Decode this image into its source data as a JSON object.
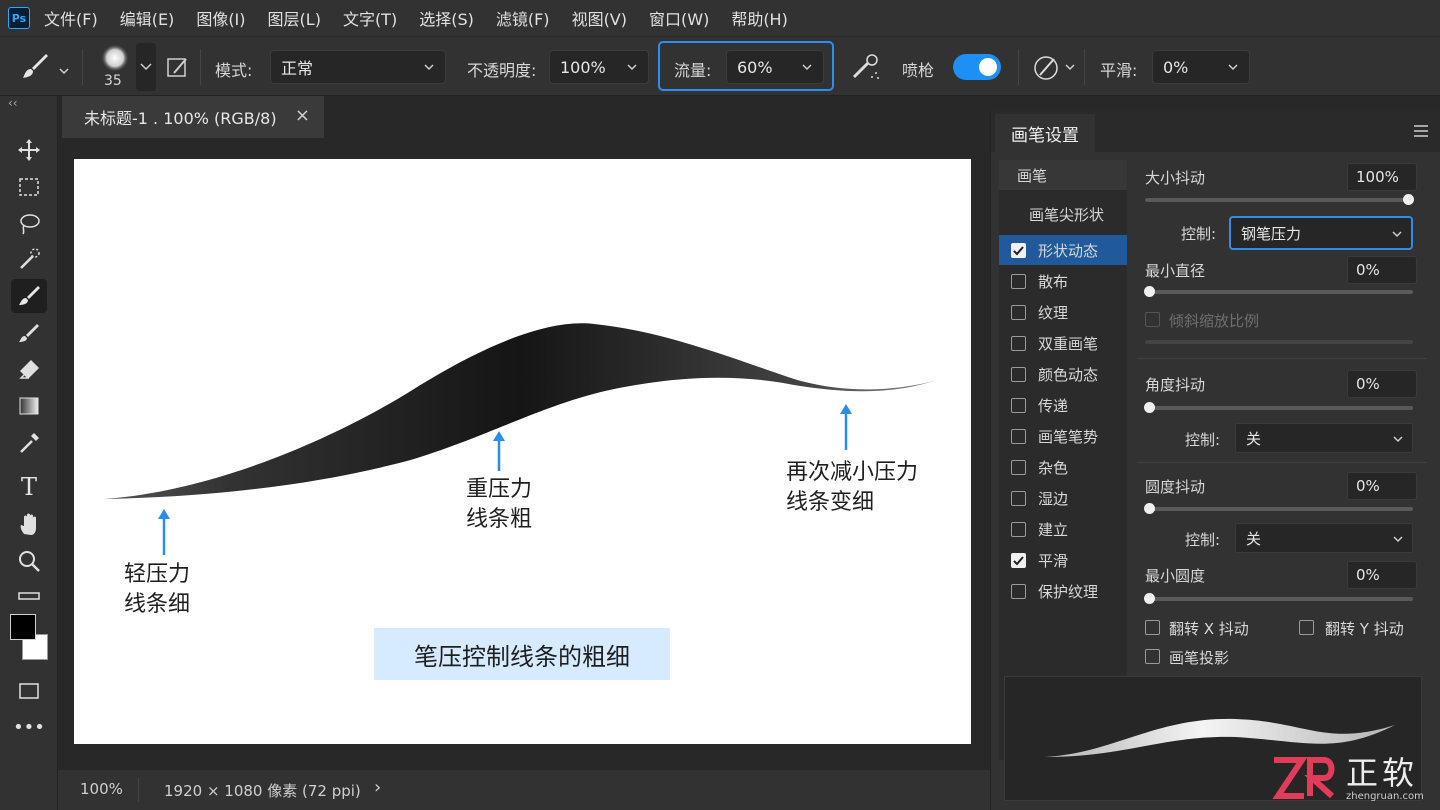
{
  "app": {
    "logo": "Ps"
  },
  "menu": [
    "文件(F)",
    "编辑(E)",
    "图像(I)",
    "图层(L)",
    "文字(T)",
    "选择(S)",
    "滤镜(F)",
    "视图(V)",
    "窗口(W)",
    "帮助(H)"
  ],
  "options": {
    "brush_size": "35",
    "mode_label": "模式:",
    "mode_value": "正常",
    "opacity_label": "不透明度:",
    "opacity_value": "100%",
    "flow_label": "流量:",
    "flow_value": "60%",
    "airbrush_label": "喷枪",
    "smoothing_label": "平滑:",
    "smoothing_value": "0%"
  },
  "document": {
    "tab_title": "未标题-1 . 100% (RGB/8)",
    "close_glyph": "×"
  },
  "canvas": {
    "anno_light_1": "轻压力",
    "anno_light_2": "线条细",
    "anno_heavy_1": "重压力",
    "anno_heavy_2": "线条粗",
    "anno_reduce_1": "再次减小压力",
    "anno_reduce_2": "线条变细",
    "caption": "笔压控制线条的粗细"
  },
  "status": {
    "zoom": "100%",
    "doc_info": "1920 × 1080 像素 (72 ppi)",
    "arrow": "›"
  },
  "panel": {
    "title": "画笔设置",
    "side": {
      "brush": "画笔",
      "tip_shape": "画笔尖形状",
      "items": [
        {
          "label": "形状动态",
          "checked": true
        },
        {
          "label": "散布",
          "checked": false
        },
        {
          "label": "纹理",
          "checked": false
        },
        {
          "label": "双重画笔",
          "checked": false
        },
        {
          "label": "颜色动态",
          "checked": false
        },
        {
          "label": "传递",
          "checked": false
        },
        {
          "label": "画笔笔势",
          "checked": false
        },
        {
          "label": "杂色",
          "checked": false
        },
        {
          "label": "湿边",
          "checked": false
        },
        {
          "label": "建立",
          "checked": false
        },
        {
          "label": "平滑",
          "checked": true
        },
        {
          "label": "保护纹理",
          "checked": false
        }
      ]
    },
    "size_jitter_label": "大小抖动",
    "size_jitter_value": "100%",
    "size_jitter_level": 1.0,
    "control_label": "控制:",
    "control_value": "钢笔压力",
    "min_diameter_label": "最小直径",
    "min_diameter_value": "0%",
    "min_diameter_level": 0,
    "tilt_scale_label": "倾斜缩放比例",
    "angle_jitter_label": "角度抖动",
    "angle_jitter_value": "0%",
    "angle_control_value": "关",
    "roundness_jitter_label": "圆度抖动",
    "roundness_jitter_value": "0%",
    "roundness_control_value": "关",
    "min_roundness_label": "最小圆度",
    "min_roundness_value": "0%",
    "flip_x_label": "翻转 X 抖动",
    "flip_y_label": "翻转 Y 抖动",
    "brush_projection_label": "画笔投影"
  },
  "watermark": {
    "brand": "正软",
    "url": "zhengruan.com"
  },
  "colors": {
    "accent": "#2e8ef0",
    "toggle": "#1e8ff4",
    "selected": "#215a9a",
    "caption_bg": "#d6ebff"
  }
}
